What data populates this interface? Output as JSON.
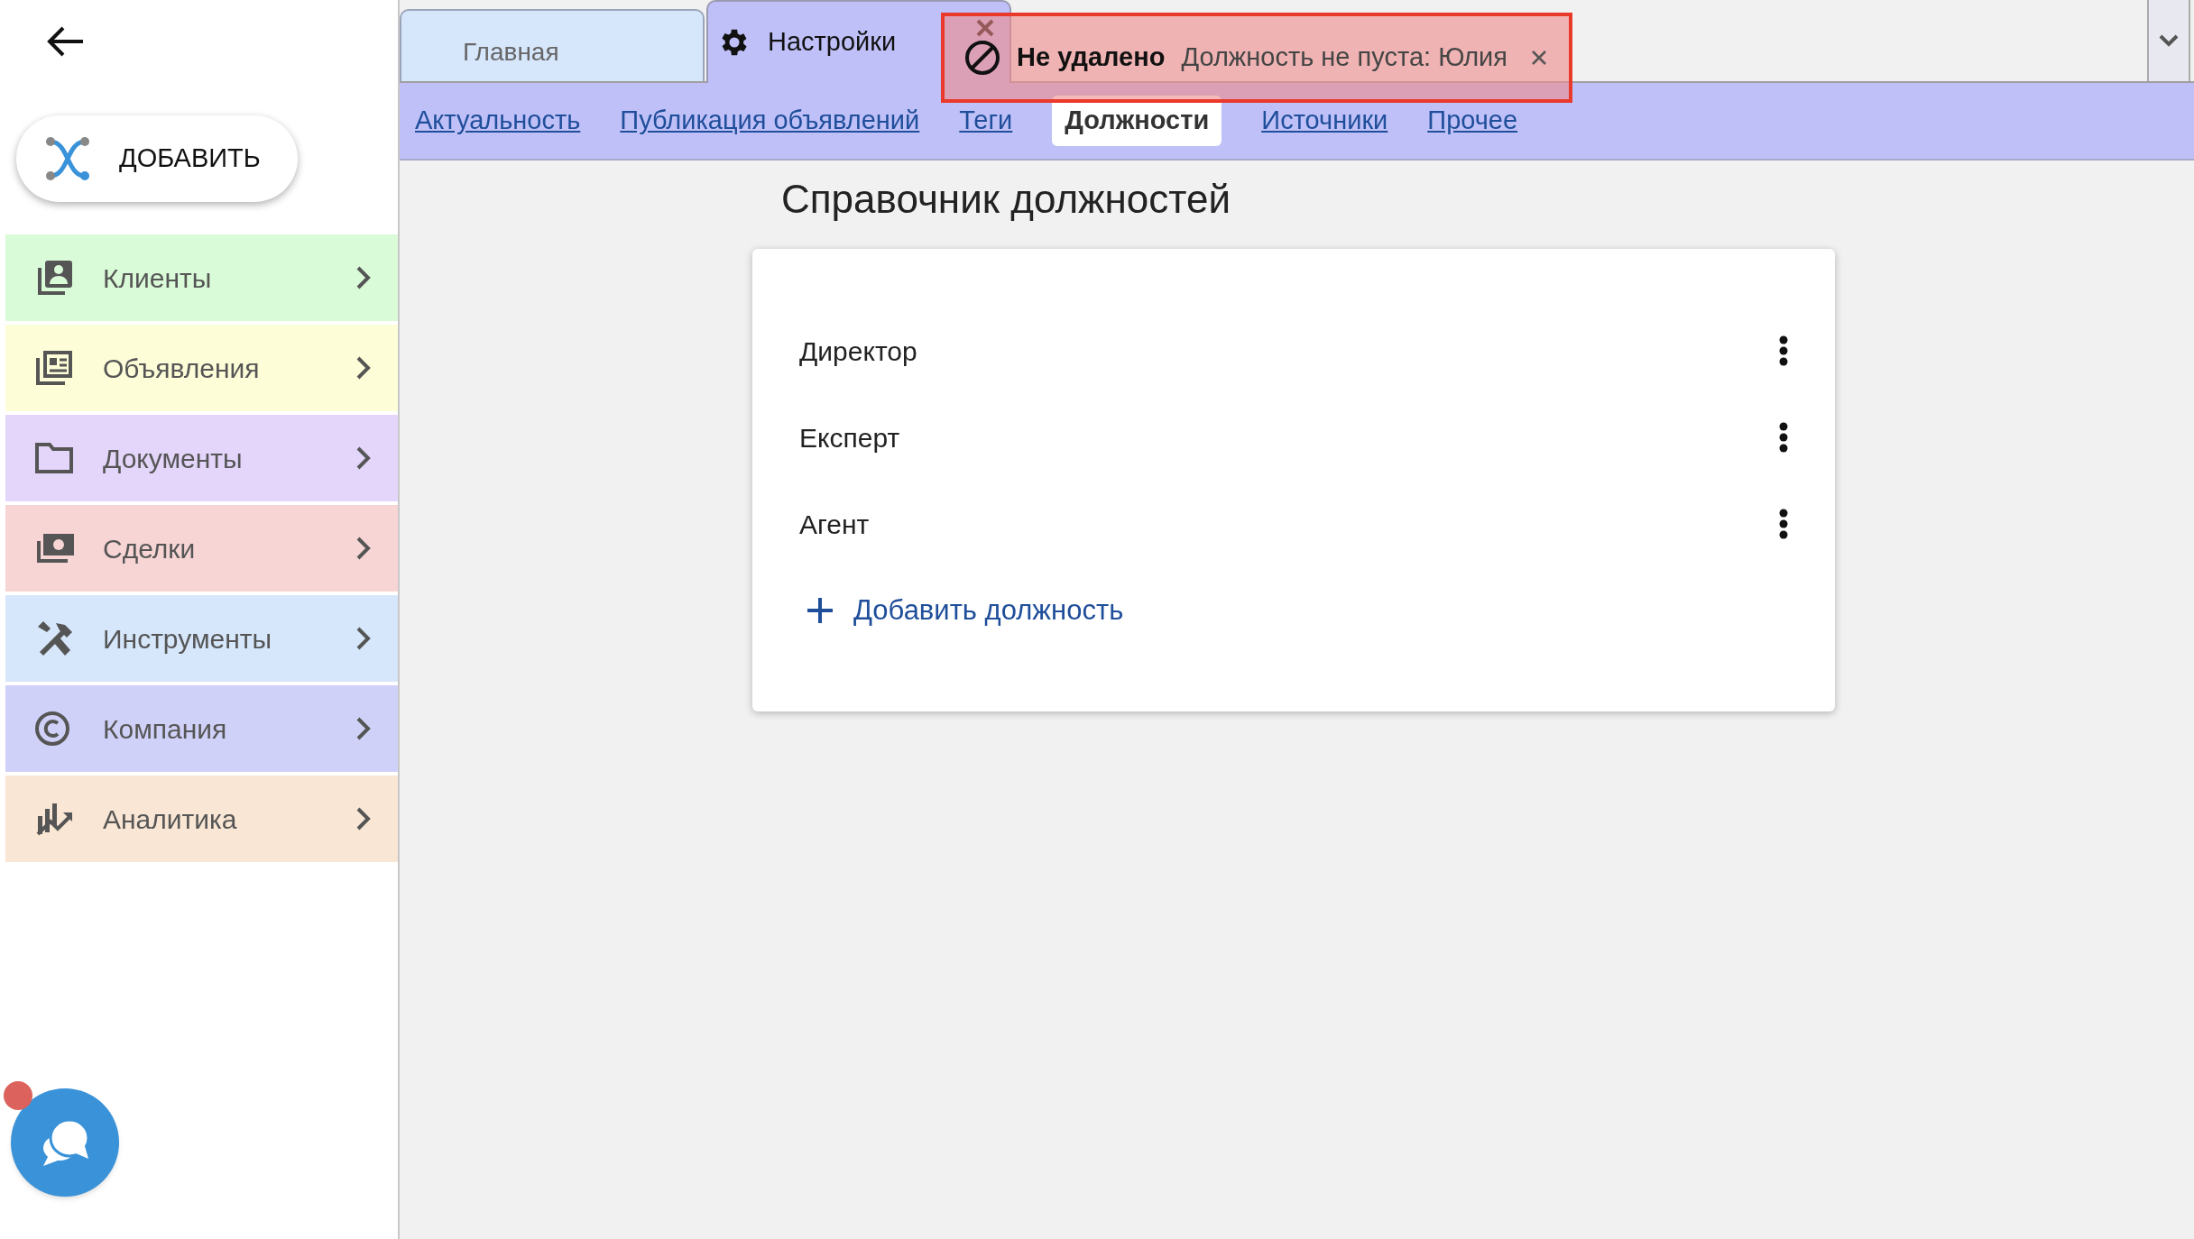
{
  "sidebar": {
    "add_button": "ДОБАВИТЬ",
    "items": [
      {
        "label": "Клиенты",
        "color": "#dafbd8"
      },
      {
        "label": "Объявления",
        "color": "#fdfdd8"
      },
      {
        "label": "Документы",
        "color": "#e4d5fb"
      },
      {
        "label": "Сделки",
        "color": "#f8d5d5"
      },
      {
        "label": "Инструменты",
        "color": "#d6e6fb"
      },
      {
        "label": "Компания",
        "color": "#d0d1f8"
      },
      {
        "label": "Аналитика",
        "color": "#f9e6d4"
      }
    ],
    "chat": {
      "unread": true
    }
  },
  "tabs": [
    {
      "label": "Главная",
      "selected": false
    },
    {
      "label": "Настройки",
      "selected": true
    }
  ],
  "subtabs": [
    {
      "label": "Актуальность",
      "selected": false
    },
    {
      "label": "Публикация объявлений",
      "selected": false
    },
    {
      "label": "Теги",
      "selected": false
    },
    {
      "label": "Должности",
      "selected": true
    },
    {
      "label": "Источники",
      "selected": false
    },
    {
      "label": "Прочее",
      "selected": false
    }
  ],
  "title": "Справочник должностей",
  "positions": [
    "Директор",
    "Експерт",
    "Агент"
  ],
  "add_position": "Добавить должность",
  "toast": {
    "title": "Не удалено",
    "message": "Должность не пуста: Юлия"
  }
}
